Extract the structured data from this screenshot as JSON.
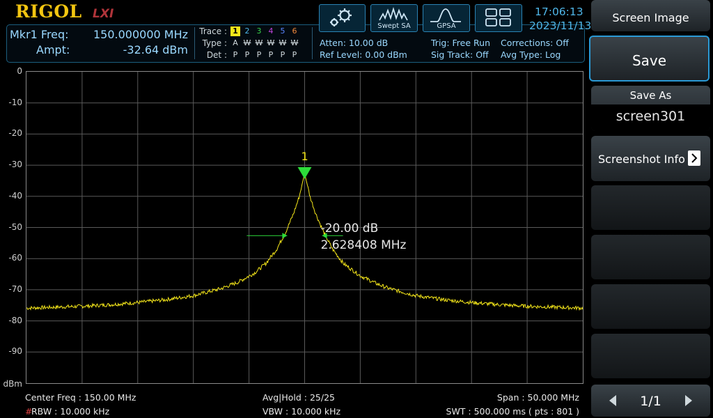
{
  "brand": {
    "logo": "RIGOL",
    "lxi": "LXI"
  },
  "marker": {
    "freq_label": "Mkr1 Freq:",
    "freq_value": "150.000000 MHz",
    "ampt_label": "Ampt:",
    "ampt_value": "-32.64 dBm",
    "number": "1"
  },
  "trace_table": {
    "trace_label": "Trace :",
    "type_label": "Type :",
    "det_label": "Det :",
    "traces": [
      {
        "num": "1",
        "type": "A",
        "det": "P",
        "color": "#f4e61a"
      },
      {
        "num": "2",
        "type": "W",
        "det": "P",
        "color": "#4fb6e8"
      },
      {
        "num": "3",
        "type": "W",
        "det": "P",
        "color": "#39d24a"
      },
      {
        "num": "4",
        "type": "W",
        "det": "P",
        "color": "#c246e0"
      },
      {
        "num": "5",
        "type": "W",
        "det": "P",
        "color": "#5a86ff"
      },
      {
        "num": "6",
        "type": "W",
        "det": "P",
        "color": "#f08a3c"
      }
    ]
  },
  "settings": {
    "atten": "Atten: 10.00 dB",
    "ref_level": "Ref Level: 0.00 dBm",
    "trig": "Trig: Free Run",
    "sig_track": "Sig Track: Off",
    "corrections": "Corrections: Off",
    "avg_type": "Avg Type: Log"
  },
  "mode_buttons": [
    {
      "icon": "gear-icon",
      "label": ""
    },
    {
      "icon": "swept-sa-icon",
      "label": "Swept SA"
    },
    {
      "icon": "gpsa-icon",
      "label": "GPSA"
    },
    {
      "icon": "layout-grid-icon",
      "label": ""
    }
  ],
  "clock": {
    "time": "17:06:13",
    "date": "2023/11/13"
  },
  "softkeys": {
    "screen_image": "Screen Image",
    "save": "Save",
    "save_as_title": "Save As",
    "save_as_value": "screen301",
    "screenshot_info": "Screenshot Info",
    "page": "1/1"
  },
  "chart_data": {
    "type": "line",
    "y_unit": "dBm",
    "ylim": [
      -100,
      0
    ],
    "y_ticks": [
      "0",
      "-10",
      "-20",
      "-30",
      "-40",
      "-50",
      "-60",
      "-70",
      "-80",
      "-90"
    ],
    "xlim_mhz": [
      125,
      175
    ],
    "grid": true,
    "series": [
      {
        "color": "#f4e61a",
        "x_mhz": [
          125,
          127.5,
          130,
          132.5,
          135,
          137.5,
          140,
          142.5,
          144,
          145.5,
          146.5,
          147.5,
          148.3,
          149,
          149.5,
          150,
          150.5,
          151,
          151.7,
          152.5,
          153.5,
          155,
          156.5,
          157.5,
          160,
          162.5,
          165,
          167.5,
          170,
          172.5,
          175
        ],
        "y_dbm": [
          -75.9,
          -75.6,
          -75.3,
          -74.8,
          -74.1,
          -73.2,
          -71.9,
          -69.6,
          -67.6,
          -64.6,
          -61.6,
          -56.9,
          -51.5,
          -45.6,
          -40.3,
          -32.64,
          -40.3,
          -45.6,
          -51.5,
          -56.9,
          -61.6,
          -65.5,
          -68.1,
          -69.5,
          -71.9,
          -73.2,
          -74.1,
          -74.8,
          -75.3,
          -75.6,
          -75.9
        ]
      }
    ],
    "marker": {
      "label": "1",
      "x_mhz": 150,
      "y_dbm": -32.64
    },
    "bandwidth_annotation": {
      "level": "-20.00 dB",
      "width": "2.628408 MHz",
      "y_dbm": -52.64
    }
  },
  "footer": {
    "center_freq": "Center Freq : 150.00 MHz",
    "rbw_hash": "#",
    "rbw": "RBW : 10.000 kHz",
    "avg_hold": "Avg|Hold : 25/25",
    "vbw": "VBW : 10.000 kHz",
    "span": "Span : 50.000 MHz",
    "swt": "SWT : 500.000 ms ( pts : 801 )"
  },
  "colors": {
    "accent": "#2a83b5",
    "trace": "#f4e61a",
    "marker": "#2ddc3a"
  }
}
